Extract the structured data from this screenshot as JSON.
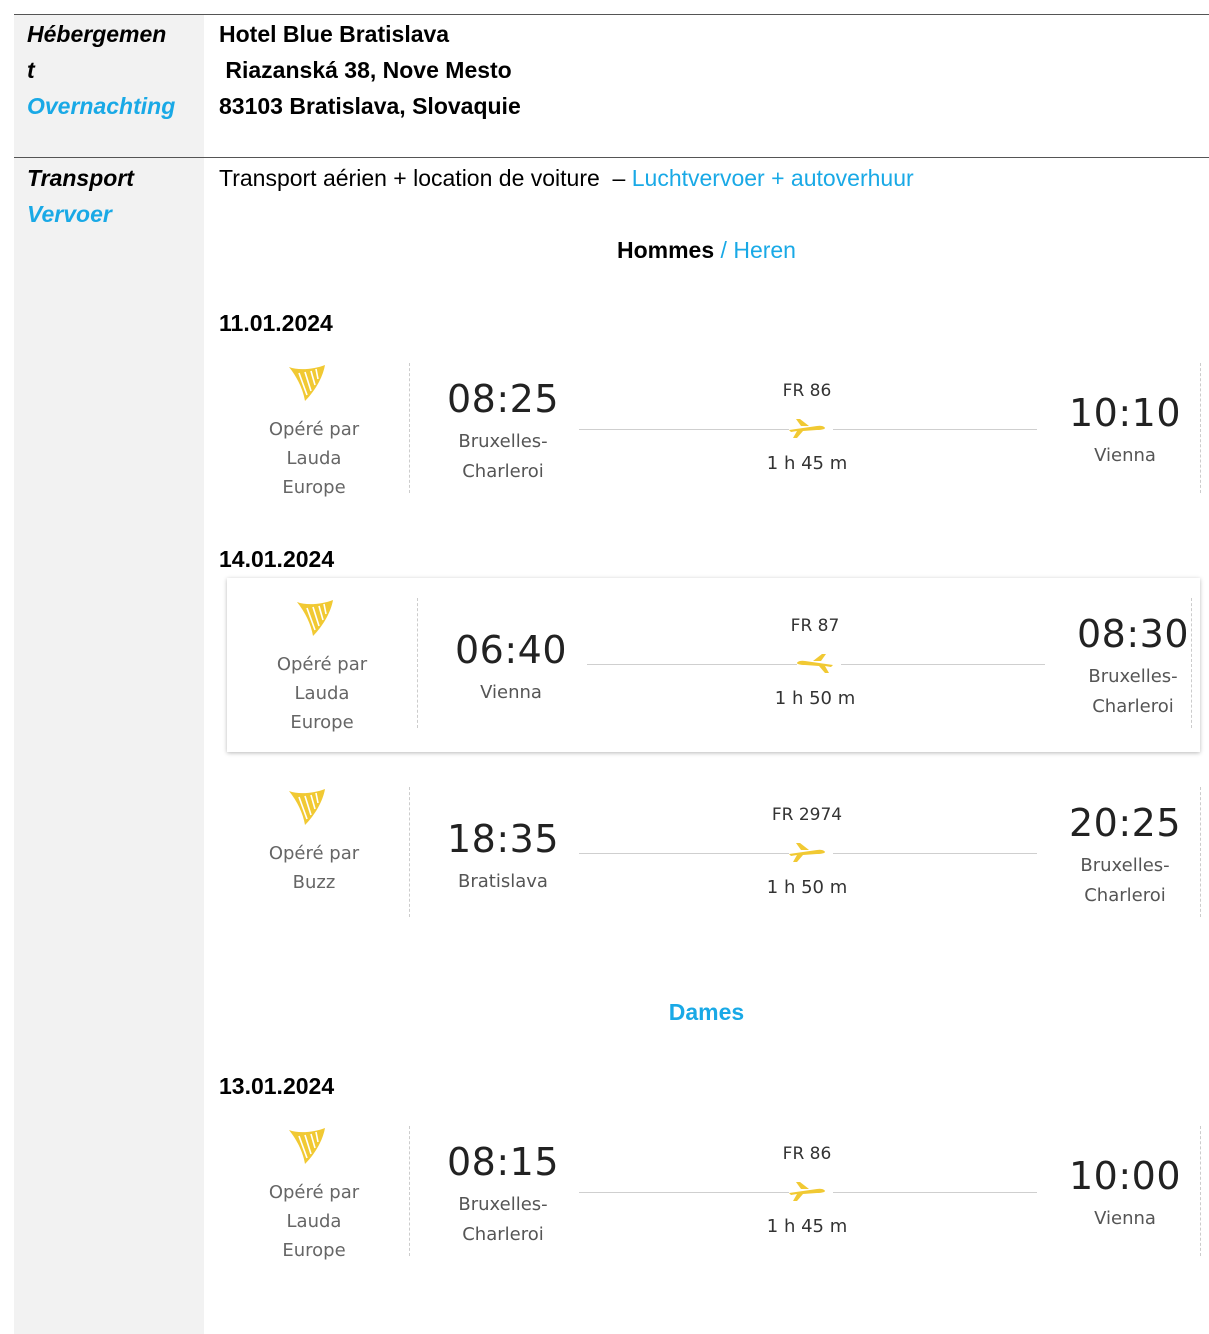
{
  "accommodation": {
    "label_fr_1": "Hébergemen",
    "label_fr_2": "t",
    "label_nl": "Overnachting",
    "lines": [
      "Hotel Blue Bratislava",
      " Riazanská 38, Nove Mesto",
      "83103 Bratislava, Slovaquie"
    ]
  },
  "transport": {
    "label_fr": "Transport",
    "label_nl": "Vervoer",
    "desc_fr": "Transport aérien + location de voiture  – ",
    "desc_nl": "Luchtvervoer + autoverhuur"
  },
  "men": {
    "title_fr": "Hommes",
    "sep": " / ",
    "title_nl": "Heren"
  },
  "women": {
    "title": "Dames"
  },
  "colors": {
    "accent_blue": "#19a9e6",
    "ryanair_yellow": "#f1c933"
  },
  "groups": [
    {
      "date": "11.01.2024",
      "flights": [
        {
          "logo": "ryanair-harp-icon",
          "operator": [
            "Opéré par",
            "Lauda",
            "Europe"
          ],
          "dep_time": "08:25",
          "dep_city": [
            "Bruxelles-",
            "Charleroi"
          ],
          "flight_no": "FR 86",
          "duration": "1 h 45 m",
          "arr_time": "10:10",
          "arr_city": [
            "Vienna"
          ],
          "plane": "plane-icon"
        }
      ]
    },
    {
      "date": "14.01.2024",
      "flights": [
        {
          "logo": "ryanair-harp-icon",
          "operator": [
            "Opéré par",
            "Lauda",
            "Europe"
          ],
          "dep_time": "06:40",
          "dep_city": [
            "Vienna"
          ],
          "flight_no": "FR 87",
          "duration": "1 h 50 m",
          "arr_time": "08:30",
          "arr_city": [
            "Bruxelles-",
            "Charleroi"
          ],
          "plane": "plane-icon"
        },
        {
          "logo": "ryanair-harp-icon",
          "operator": [
            "Opéré par",
            "Buzz"
          ],
          "dep_time": "18:35",
          "dep_city": [
            "Bratislava"
          ],
          "flight_no": "FR 2974",
          "duration": "1 h 50 m",
          "arr_time": "20:25",
          "arr_city": [
            "Bruxelles-",
            "Charleroi"
          ],
          "plane": "plane-icon"
        }
      ]
    },
    {
      "date": "13.01.2024",
      "flights": [
        {
          "logo": "ryanair-harp-icon",
          "operator": [
            "Opéré par",
            "Lauda",
            "Europe"
          ],
          "dep_time": "08:15",
          "dep_city": [
            "Bruxelles-",
            "Charleroi"
          ],
          "flight_no": "FR 86",
          "duration": "1 h 45 m",
          "arr_time": "10:00",
          "arr_city": [
            "Vienna"
          ],
          "plane": "plane-icon"
        }
      ]
    }
  ]
}
